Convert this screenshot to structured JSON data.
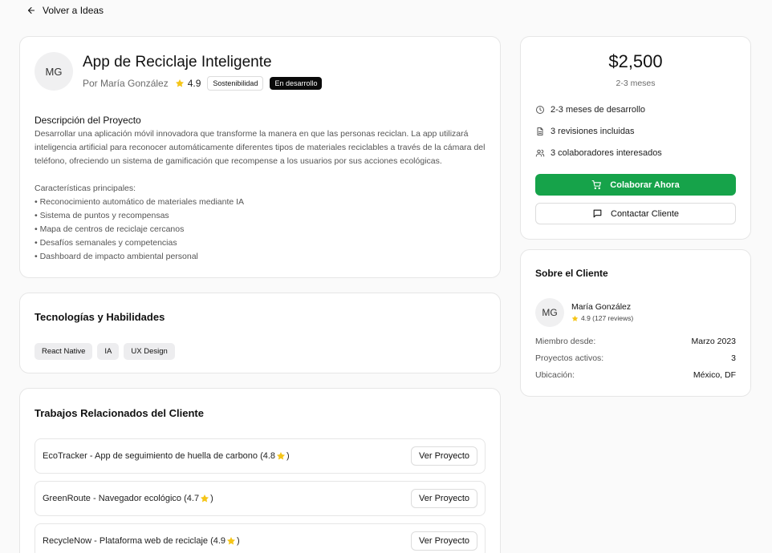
{
  "nav": {
    "back_label": "Volver a Ideas"
  },
  "project": {
    "initials": "MG",
    "title": "App de Reciclaje Inteligente",
    "author": "Por María González",
    "rating": "4.9",
    "category": "Sostenibilidad",
    "status": "En desarrollo",
    "description_title": "Descripción del Proyecto",
    "description": "Desarrollar una aplicación móvil innovadora que transforme la manera en que las personas reciclan. La app utilizará inteligencia artificial para reconocer automáticamente diferentes tipos de materiales reciclables a través de la cámara del teléfono, ofreciendo un sistema de gamificación que recompense a los usuarios por sus acciones ecológicas.",
    "features_title": "Características principales:",
    "features": [
      "• Reconocimiento automático de materiales mediante IA",
      "• Sistema de puntos y recompensas",
      "• Mapa de centros de reciclaje cercanos",
      "• Desafíos semanales y competencias",
      "• Dashboard de impacto ambiental personal"
    ]
  },
  "tech": {
    "title": "Tecnologías y Habilidades",
    "tags": [
      "React Native",
      "IA",
      "UX Design"
    ]
  },
  "related": {
    "title": "Trabajos Relacionados del Cliente",
    "items": [
      {
        "name": "EcoTracker - App de seguimiento de huella de carbono (4.8",
        "suffix": ")",
        "button": "Ver Proyecto"
      },
      {
        "name": "GreenRoute - Navegador ecológico (4.7",
        "suffix": ")",
        "button": "Ver Proyecto"
      },
      {
        "name": "RecycleNow - Plataforma web de reciclaje (4.9",
        "suffix": ")",
        "button": "Ver Proyecto"
      }
    ]
  },
  "pricing": {
    "price": "$2,500",
    "duration": "2-3 meses",
    "info": [
      {
        "icon": "clock-icon",
        "text": "2-3 meses de desarrollo"
      },
      {
        "icon": "document-icon",
        "text": "3 revisiones incluidas"
      },
      {
        "icon": "users-icon",
        "text": "3 colaboradores interesados"
      }
    ],
    "primary_button": "Colaborar Ahora",
    "secondary_button": "Contactar Cliente"
  },
  "client": {
    "title": "Sobre el Cliente",
    "initials": "MG",
    "name": "María González",
    "rating": "4.9 (127 reviews)",
    "details": [
      {
        "key": "Miembro desde:",
        "value": "Marzo 2023"
      },
      {
        "key": "Proyectos activos:",
        "value": "3"
      },
      {
        "key": "Ubicación:",
        "value": "México, DF"
      }
    ]
  },
  "colors": {
    "accent": "#16a34a",
    "star": "#f5c518",
    "dark_badge": "#0a0a0a"
  }
}
